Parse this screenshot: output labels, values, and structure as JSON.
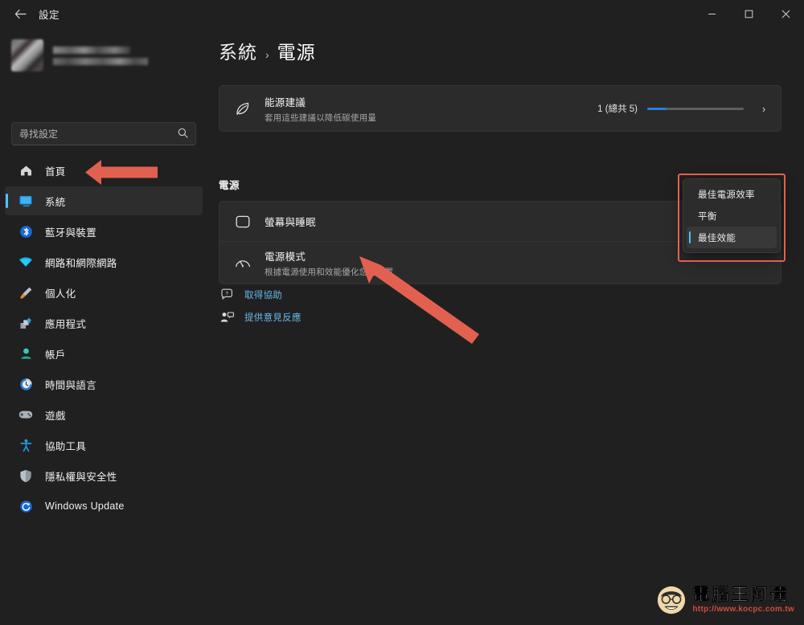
{
  "window": {
    "title": "設定",
    "back_icon": "back-arrow-icon",
    "minimize_label": "—",
    "maximize_label": "□",
    "close_label": "✕"
  },
  "sidebar": {
    "profile": {
      "avatar": "user-avatar-blurred",
      "name_blurred": true,
      "email_blurred": true
    },
    "search": {
      "placeholder": "尋找設定",
      "value": "",
      "icon": "search-icon"
    },
    "items": [
      {
        "label": "首頁",
        "icon": "home-icon",
        "selected": false
      },
      {
        "label": "系統",
        "icon": "monitor-icon",
        "selected": true
      },
      {
        "label": "藍牙與裝置",
        "icon": "bluetooth-icon",
        "selected": false
      },
      {
        "label": "網路和網際網路",
        "icon": "wifi-icon",
        "selected": false
      },
      {
        "label": "個人化",
        "icon": "paintbrush-icon",
        "selected": false
      },
      {
        "label": "應用程式",
        "icon": "apps-icon",
        "selected": false
      },
      {
        "label": "帳戶",
        "icon": "person-icon",
        "selected": false
      },
      {
        "label": "時間與語言",
        "icon": "clock-icon",
        "selected": false
      },
      {
        "label": "遊戲",
        "icon": "gamepad-icon",
        "selected": false
      },
      {
        "label": "協助工具",
        "icon": "accessibility-icon",
        "selected": false
      },
      {
        "label": "隱私權與安全性",
        "icon": "shield-icon",
        "selected": false
      },
      {
        "label": "Windows Update",
        "icon": "update-refresh-icon",
        "selected": false
      }
    ]
  },
  "main": {
    "breadcrumb": {
      "root": "系統",
      "separator": "›",
      "leaf": "電源"
    },
    "energy_card": {
      "icon": "energy-leaf-icon",
      "title": "能源建議",
      "subtitle": "套用這些建議以降低碳使用量",
      "progress_text": "1 (總共 5)",
      "progress_percent": 20,
      "chevron": "›"
    },
    "section_title": "電源",
    "rows": [
      {
        "icon": "screen-sleep-icon",
        "title": "螢幕與睡眠",
        "subtitle": ""
      },
      {
        "icon": "power-gauge-icon",
        "title": "電源模式",
        "subtitle": "根據電源使用和效能優化您的裝置"
      }
    ],
    "dropdown": {
      "options": [
        {
          "label": "最佳電源效率",
          "selected": false
        },
        {
          "label": "平衡",
          "selected": false
        },
        {
          "label": "最佳效能",
          "selected": true
        }
      ]
    },
    "links": [
      {
        "label": "取得協助",
        "icon": "help-question-icon"
      },
      {
        "label": "提供意見反應",
        "icon": "feedback-icon"
      }
    ]
  },
  "annotations": {
    "arrow_color": "#e2604f",
    "highlight_box_color": "#e2604f",
    "arrow_sidebar": "points-to-system-sidebar-item",
    "arrow_power_mode": "points-to-power-mode-row"
  },
  "watermark": {
    "brand": "電腦王阿達",
    "url": "http://www.kocpc.com.tw"
  },
  "colors": {
    "accent": "#4cc2ff",
    "progress": "#2a7fd4",
    "link": "#68b7e8",
    "background": "#202020",
    "card": "#2b2b2b"
  }
}
